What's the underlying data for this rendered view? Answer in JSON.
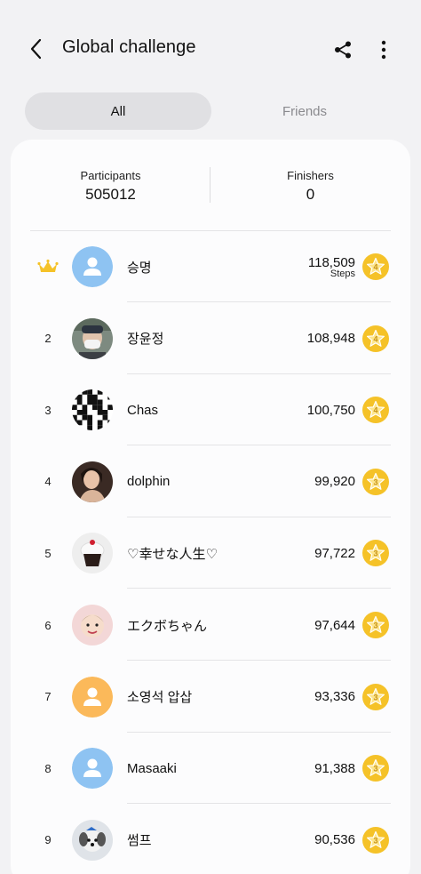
{
  "header": {
    "title": "Global challenge"
  },
  "tabs": [
    {
      "label": "All",
      "active": true
    },
    {
      "label": "Friends",
      "active": false
    }
  ],
  "stats": {
    "participants_label": "Participants",
    "participants_value": "505012",
    "finishers_label": "Finishers",
    "finishers_value": "0"
  },
  "colors": {
    "accent_gold": "#f5c228",
    "default_avatar_blue": "#8ec3f2",
    "default_avatar_orange": "#fbb95a"
  },
  "leaderboard": [
    {
      "rank": "",
      "rank_icon": "crown-icon",
      "name": "승명",
      "steps": "118,509",
      "unit": "Steps",
      "badge": "4",
      "avatar": "default-blue"
    },
    {
      "rank": "2",
      "name": "장윤정",
      "steps": "108,948",
      "unit": "",
      "badge": "4",
      "avatar": "photo-masked-person"
    },
    {
      "rank": "3",
      "name": "Chas",
      "steps": "100,750",
      "unit": "",
      "badge": "4",
      "avatar": "photo-qr-pattern"
    },
    {
      "rank": "4",
      "name": "dolphin",
      "steps": "99,920",
      "unit": "",
      "badge": "3",
      "avatar": "photo-woman"
    },
    {
      "rank": "5",
      "name": "♡幸せな人生♡",
      "steps": "97,722",
      "unit": "",
      "badge": "3",
      "avatar": "photo-cupcake"
    },
    {
      "rank": "6",
      "name": "エクボちゃん",
      "steps": "97,644",
      "unit": "",
      "badge": "3",
      "avatar": "photo-baby"
    },
    {
      "rank": "7",
      "name": "소영석 압삽",
      "steps": "93,336",
      "unit": "",
      "badge": "3",
      "avatar": "default-orange"
    },
    {
      "rank": "8",
      "name": "Masaaki",
      "steps": "91,388",
      "unit": "",
      "badge": "3",
      "avatar": "default-blue"
    },
    {
      "rank": "9",
      "name": "썸프",
      "steps": "90,536",
      "unit": "",
      "badge": "3",
      "avatar": "photo-dog"
    }
  ]
}
